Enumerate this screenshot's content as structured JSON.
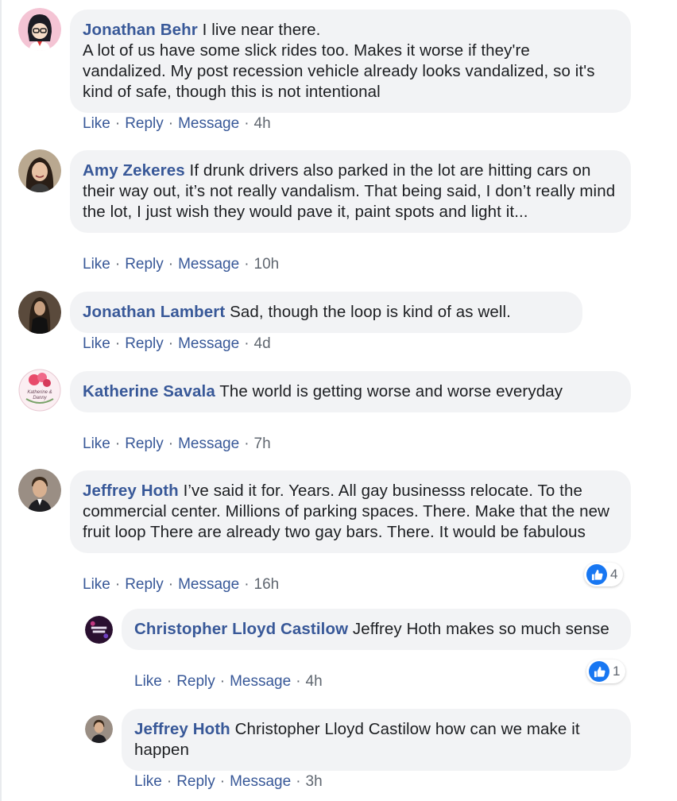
{
  "actions": {
    "like": "Like",
    "reply": "Reply",
    "message": "Message",
    "dot": "·"
  },
  "comments": [
    {
      "author": "Jonathan Behr",
      "text": "I live near there.",
      "text2": "A lot of us have some slick rides too. Makes it worse if they're vandalized. My post recession vehicle already looks vandalized, so it's kind of safe, though this is not intentional",
      "time": "4h"
    },
    {
      "author": "Amy Zekeres",
      "text": "If drunk drivers also parked in the lot are hitting cars on their way out, it’s not really vandalism. That being said, I don’t really mind the lot, I just wish they would pave it, paint spots and light it...",
      "time": "10h"
    },
    {
      "author": "Jonathan Lambert",
      "text": "Sad, though the loop is kind of as well.",
      "time": "4d"
    },
    {
      "author": "Katherine Savala",
      "text": "The world is getting worse and worse everyday",
      "time": "7h",
      "avatar_text": "Katherine & Danny"
    },
    {
      "author": "Jeffrey Hoth",
      "text": "I’ve said it for. Years. All gay businesss relocate. To the commercial center. Millions of parking spaces. There. Make that the new fruit loop There are already two gay bars. There. It would be fabulous",
      "time": "16h",
      "reactions": "4"
    }
  ],
  "replies": [
    {
      "author": "Christopher Lloyd Castilow",
      "text": "Jeffrey Hoth makes so much sense",
      "time": "4h",
      "reactions": "1"
    },
    {
      "author": "Jeffrey Hoth",
      "text": "Christopher Lloyd Castilow how can we make it happen",
      "time": "3h"
    }
  ],
  "colors": {
    "link": "#385898",
    "bubble": "#f2f3f5",
    "meta": "#606770",
    "like_blue": "#1877f2"
  },
  "icons": {
    "reaction": "thumbs-up-icon"
  }
}
